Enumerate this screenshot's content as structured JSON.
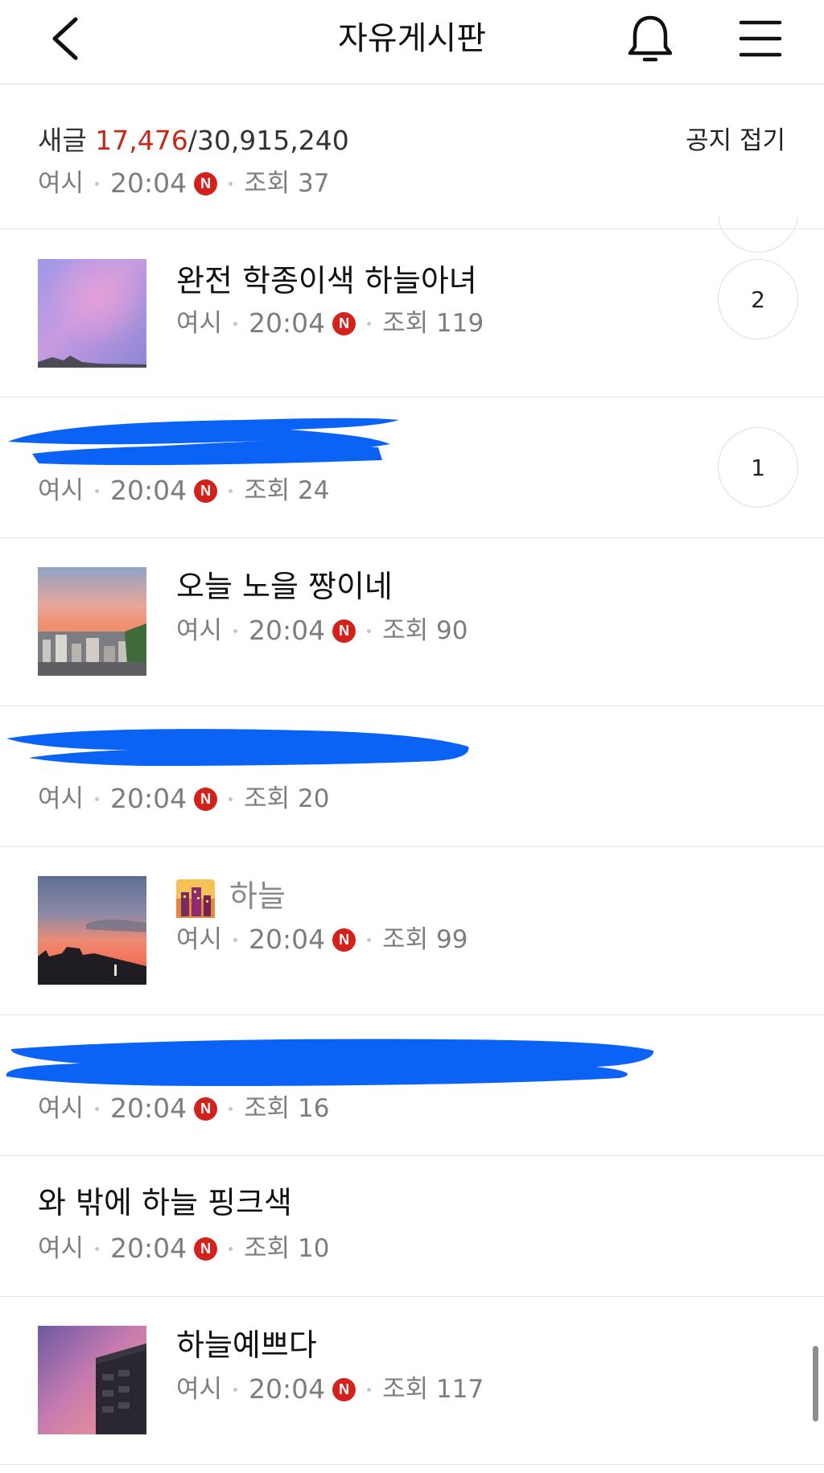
{
  "header": {
    "title": "자유게시판",
    "back_icon": "chevron-left-icon",
    "bell_icon": "bell-icon",
    "menu_icon": "hamburger-menu-icon"
  },
  "notice": {
    "label": "새글",
    "new_count": "17,476",
    "separator": "/",
    "total_count": "30,915,240",
    "fold_label": "공지 접기"
  },
  "colors": {
    "accent_red": "#c42a1b",
    "badge_red": "#d3211c",
    "redaction_blue": "#0b63f5"
  },
  "posts": [
    {
      "title": "",
      "author": "여시",
      "time": "20:04",
      "badge": "N",
      "views_label": "조회 37",
      "comments": ""
    },
    {
      "title": "완전 학종이색 하늘아녀",
      "author": "여시",
      "time": "20:04",
      "badge": "N",
      "views_label": "조회 119",
      "comments": "2"
    },
    {
      "title": "",
      "author": "여시",
      "time": "20:04",
      "badge": "N",
      "views_label": "조회 24",
      "comments": "1"
    },
    {
      "title": "오늘 노을 짱이네",
      "author": "여시",
      "time": "20:04",
      "badge": "N",
      "views_label": "조회 90",
      "comments": ""
    },
    {
      "title": "",
      "author": "여시",
      "time": "20:04",
      "badge": "N",
      "views_label": "조회 20",
      "comments": ""
    },
    {
      "title": "하늘",
      "author": "여시",
      "time": "20:04",
      "badge": "N",
      "views_label": "조회 99",
      "comments": ""
    },
    {
      "title": "",
      "author": "여시",
      "time": "20:04",
      "badge": "N",
      "views_label": "조회 16",
      "comments": ""
    },
    {
      "title": "와 밖에 하늘 핑크색",
      "author": "여시",
      "time": "20:04",
      "badge": "N",
      "views_label": "조회 10",
      "comments": ""
    },
    {
      "title": "하늘예쁘다",
      "author": "여시",
      "time": "20:04",
      "badge": "N",
      "views_label": "조회 117",
      "comments": ""
    }
  ]
}
